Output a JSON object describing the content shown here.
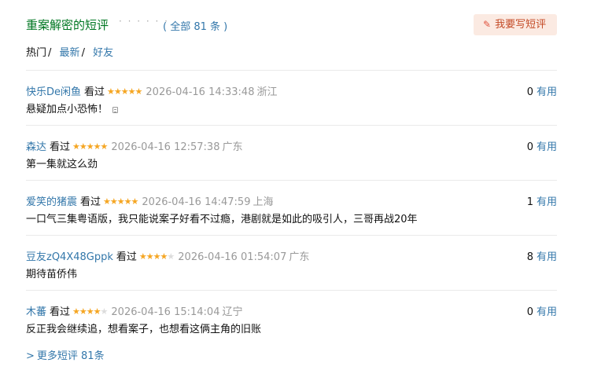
{
  "header": {
    "title": "重案解密的短评",
    "dots": "· · · · · ·",
    "all_count_prefix": "( ",
    "all_count": "全部 81 条",
    "all_count_suffix": " )",
    "write_button": "我要写短评",
    "write_icon": "pencil-icon"
  },
  "tabs": [
    {
      "label": "热门",
      "active": true
    },
    {
      "label": "最新",
      "active": false
    },
    {
      "label": "好友",
      "active": false
    }
  ],
  "tab_separator": "/",
  "vote_label": "有用",
  "status_label": "看过",
  "reviews": [
    {
      "user": "快乐De闲鱼",
      "stars": 5,
      "time": "2026-04-16 14:33:48",
      "location": "浙江",
      "votes": "0",
      "text": "悬疑加点小恐怖！",
      "has_more_icon": true
    },
    {
      "user": "森达",
      "stars": 5,
      "time": "2026-04-16 12:57:38",
      "location": "广东",
      "votes": "0",
      "text": "第一集就这么劲",
      "has_more_icon": false
    },
    {
      "user": "爱笑的猪震",
      "stars": 5,
      "time": "2026-04-16 14:47:59",
      "location": "上海",
      "votes": "1",
      "text": "一口气三集粤语版，我只能说案子好看不过瘾，港剧就是如此的吸引人，三哥再战20年",
      "has_more_icon": false
    },
    {
      "user": "豆友zQ4X48Gppk",
      "stars": 4,
      "time": "2026-04-16 01:54:07",
      "location": "广东",
      "votes": "8",
      "text": "期待苗侨伟",
      "has_more_icon": false
    },
    {
      "user": "木蕃",
      "stars": 4,
      "time": "2026-04-16 15:14:04",
      "location": "辽宁",
      "votes": "0",
      "text": "反正我会继续追，想看案子，也想看这俩主角的旧账",
      "has_more_icon": false
    }
  ],
  "more_link": {
    "arrow": ">",
    "label": "更多短评 81条"
  },
  "colors": {
    "link": "#3377aa",
    "title": "#007722",
    "star": "#f5a623",
    "button_bg": "#fbeae2",
    "button_text": "#c44b27"
  }
}
